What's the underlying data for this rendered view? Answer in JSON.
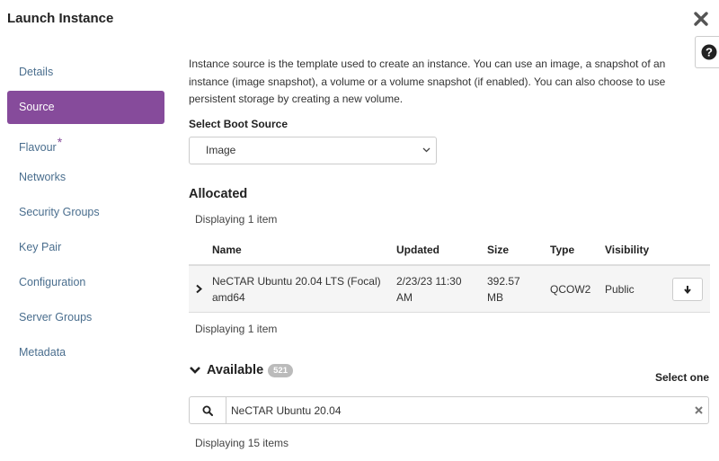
{
  "window": {
    "title": "Launch Instance"
  },
  "sidebar": {
    "items": [
      {
        "label": "Details"
      },
      {
        "label": "Source"
      },
      {
        "label": "Flavour",
        "required_mark": "*"
      },
      {
        "label": "Networks"
      },
      {
        "label": "Security Groups"
      },
      {
        "label": "Key Pair"
      },
      {
        "label": "Configuration"
      },
      {
        "label": "Server Groups"
      },
      {
        "label": "Metadata"
      }
    ],
    "active": "Source"
  },
  "main": {
    "description": "Instance source is the template used to create an instance. You can use an image, a snapshot of an instance (image snapshot), a volume or a volume snapshot (if enabled). You can also choose to use persistent storage by creating a new volume.",
    "boot_source_label": "Select Boot Source",
    "boot_source_value": "Image",
    "allocated": {
      "heading": "Allocated",
      "count_top": "Displaying 1 item",
      "count_bottom": "Displaying 1 item",
      "columns": [
        "Name",
        "Updated",
        "Size",
        "Type",
        "Visibility"
      ],
      "rows": [
        {
          "name_line1": "NeCTAR Ubuntu 20.04 LTS (Focal)",
          "name_line2": "amd64",
          "updated_line1": "2/23/23 11:30",
          "updated_line2": "AM",
          "size_line1": "392.57",
          "size_line2": "MB",
          "type": "QCOW2",
          "visibility": "Public"
        }
      ]
    },
    "available": {
      "heading": "Available",
      "badge": "521",
      "select_one": "Select one",
      "search_value": "NeCTAR Ubuntu 20.04",
      "count": "Displaying 15 items"
    }
  },
  "colors": {
    "accent": "#864b9b",
    "link": "#4a6e8e"
  },
  "icons": {
    "close": "close-icon",
    "help": "question-circle-icon",
    "chevron": "chevron-down-icon",
    "expand": "chevron-right-icon",
    "move": "arrow-down-icon",
    "search": "search-icon",
    "clear": "clear-icon"
  }
}
